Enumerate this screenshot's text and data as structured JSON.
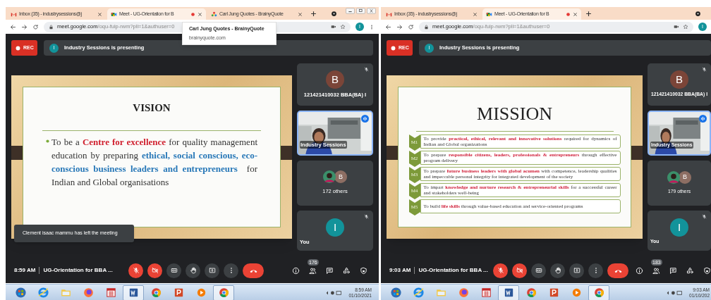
{
  "screens": [
    {
      "tabs": [
        {
          "kind": "gmail",
          "title": "Inbox (35) - industrysessions@j",
          "selected": false,
          "recording": false
        },
        {
          "kind": "meet",
          "title": "Meet - UG-Orientation for B",
          "selected": true,
          "recording": true
        },
        {
          "kind": "web",
          "title": "Carl Jung Quotes - BrainyQuote",
          "selected": false,
          "recording": false
        }
      ],
      "address": {
        "host": "meet.google.com",
        "path": "/oqu-fuip-rwm?pli=1&authuser=0",
        "profile": "I"
      },
      "tooltip": {
        "title": "Carl Jung Quotes - BrainyQuote",
        "subtitle": "brainyquote.com"
      },
      "rec": "REC",
      "presenter": {
        "letter": "I",
        "text": "Industry Sessions is presenting"
      },
      "slide": {
        "kind": "vision",
        "title": "VISION",
        "segments": [
          {
            "text": "To be a "
          },
          {
            "text": "Centre for excellence",
            "color": "#d0202e"
          },
          {
            "text": " for quality management education by preparing "
          },
          {
            "text": "ethical, social conscious, eco-conscious business leaders and entrepreneurs",
            "color": "#2878b8"
          },
          {
            "text": "  for Indian and Global organisations"
          }
        ]
      },
      "tiles": [
        {
          "kind": "avatar",
          "letter": "B",
          "color": "#7b4538",
          "name": "121421410032 BBA(BA) I",
          "muted": true,
          "speaking": false
        },
        {
          "kind": "video",
          "name": "Industry Sessions",
          "muted": false,
          "speaking": true
        },
        {
          "kind": "group",
          "letter": "B",
          "color": "#8d6e63",
          "name": "172 others",
          "muted": false,
          "speaking": false
        },
        {
          "kind": "avatar",
          "letter": "I",
          "color": "#12939a",
          "name": "You",
          "muted": true,
          "speaking": false
        }
      ],
      "toast": "Clement isaac mammu has left the meeting",
      "bottom": {
        "time": "8:59 AM",
        "title": "UG-Orientation for BBA ...",
        "people_count": "176"
      },
      "controls": [
        {
          "kind": "mic",
          "off": true
        },
        {
          "kind": "camera",
          "off": true
        },
        {
          "kind": "captions",
          "off": false
        },
        {
          "kind": "hand",
          "off": false
        },
        {
          "kind": "present",
          "off": false
        },
        {
          "kind": "more",
          "off": false
        },
        {
          "kind": "leave"
        }
      ],
      "taskbar": {
        "apps": [
          {
            "kind": "start",
            "active": false
          },
          {
            "kind": "ie",
            "active": false
          },
          {
            "kind": "folder",
            "active": false
          },
          {
            "kind": "firefox",
            "active": false
          },
          {
            "kind": "grid",
            "active": false
          },
          {
            "kind": "word",
            "active": true
          },
          {
            "kind": "chrome",
            "active": false
          },
          {
            "kind": "powerpoint",
            "active": false
          },
          {
            "kind": "media",
            "active": false
          },
          {
            "kind": "chrome",
            "active": true
          }
        ],
        "time": "8:59 AM",
        "date": "01/10/2021"
      }
    },
    {
      "tabs": [
        {
          "kind": "gmail",
          "title": "Inbox (35) - industrysessions@j",
          "selected": false,
          "recording": false
        },
        {
          "kind": "meet",
          "title": "Meet - UG-Orientation for B",
          "selected": true,
          "recording": true
        }
      ],
      "address": {
        "host": "meet.google.com",
        "path": "/oqu-fuip-rwm?pli=1&authuser=0",
        "profile": "I"
      },
      "rec": "REC",
      "presenter": {
        "letter": "I",
        "text": "Industry Sessions is presenting"
      },
      "slide": {
        "kind": "mission",
        "title": "MISSION",
        "items": [
          {
            "label": "M1",
            "text": "To provide **practical, ethical, relevant and innovative solutions** required for dynamics of Indian and Global organizations"
          },
          {
            "label": "M2",
            "text": "To prepare **responsible citizens, leaders, professionals & entrepreneurs** through effective program delivery"
          },
          {
            "label": "M3",
            "text": "To prepare **future business leaders with global acumen** with competence, leadership qualities and impeccable personal integrity for integrated development of the society"
          },
          {
            "label": "M4",
            "text": "To impart **knowledge and nurture research & entrepreneurial skills** for a successful career and stakeholders well-being"
          },
          {
            "label": "M5",
            "text": "To build **life skills** through value-based education and service-oriented programs"
          }
        ]
      },
      "tiles": [
        {
          "kind": "avatar",
          "letter": "B",
          "color": "#7b4538",
          "name": "121421410032 BBA(BA) I",
          "muted": true,
          "speaking": false
        },
        {
          "kind": "video",
          "name": "Industry Sessions",
          "muted": false,
          "speaking": true
        },
        {
          "kind": "group",
          "letter": "B",
          "color": "#8d6e63",
          "name": "179 others",
          "muted": false,
          "speaking": false
        },
        {
          "kind": "avatar",
          "letter": "I",
          "color": "#12939a",
          "name": "You",
          "muted": true,
          "speaking": false
        }
      ],
      "bottom": {
        "time": "9:03 AM",
        "title": "UG-Orientation for BBA ...",
        "people_count": "183"
      },
      "controls": [
        {
          "kind": "mic",
          "off": true
        },
        {
          "kind": "camera",
          "off": true
        },
        {
          "kind": "captions",
          "off": false
        },
        {
          "kind": "hand",
          "off": false
        },
        {
          "kind": "present",
          "off": false
        },
        {
          "kind": "more",
          "off": false
        },
        {
          "kind": "leave"
        }
      ],
      "taskbar": {
        "apps": [
          {
            "kind": "start",
            "active": false
          },
          {
            "kind": "ie",
            "active": false
          },
          {
            "kind": "folder",
            "active": false
          },
          {
            "kind": "firefox",
            "active": false
          },
          {
            "kind": "grid",
            "active": false
          },
          {
            "kind": "word",
            "active": true
          },
          {
            "kind": "chrome",
            "active": false
          },
          {
            "kind": "powerpoint",
            "active": false
          },
          {
            "kind": "media",
            "active": false
          },
          {
            "kind": "chrome",
            "active": true
          }
        ],
        "time": "9:03 AM",
        "date": "01/10/202"
      }
    }
  ]
}
